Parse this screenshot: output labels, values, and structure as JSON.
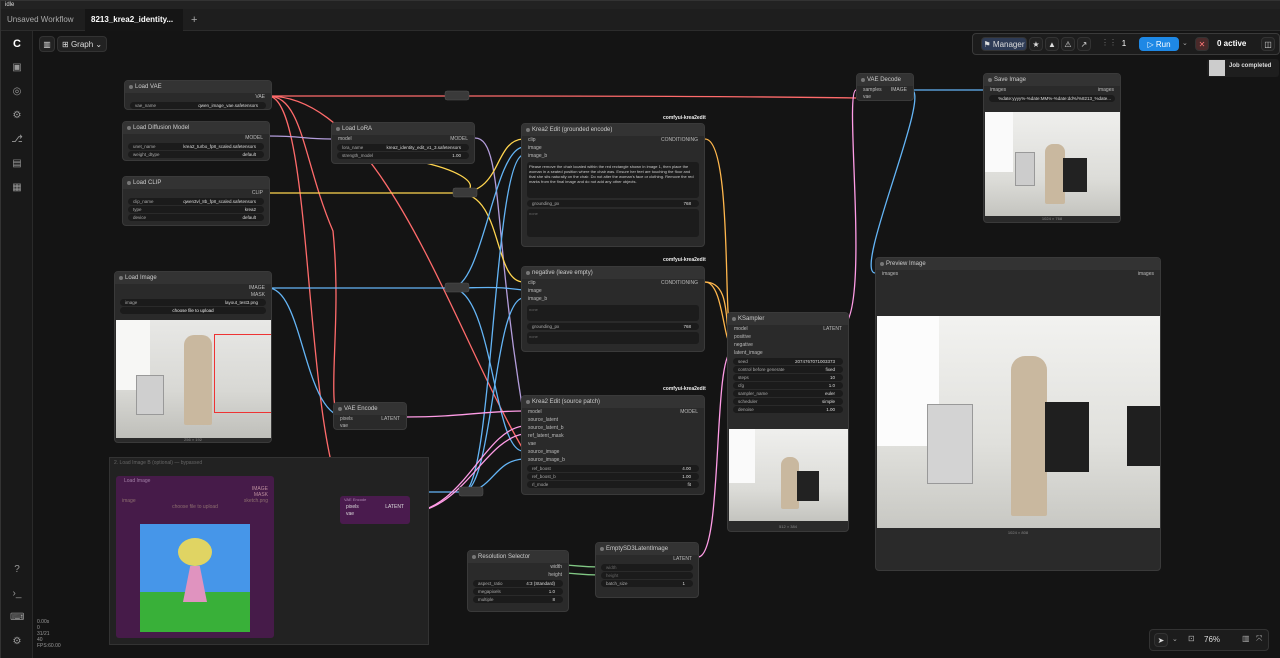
{
  "window": {
    "title": "idle"
  },
  "tabs": [
    {
      "label": "Unsaved Workflow"
    },
    {
      "label": "8213_krea2_identity..."
    }
  ],
  "toolbar": {
    "graph_label": "Graph",
    "manager_label": "Manager",
    "queue_count": "1",
    "run_label": "Run",
    "active_label": "0 active",
    "toast": "Job completed"
  },
  "stats": [
    "0.00s",
    "0",
    "31/21",
    "40",
    "FPS:60.00"
  ],
  "zoom": "76%",
  "nodes": {
    "load_vae": {
      "title": "Load VAE",
      "out": "VAE",
      "w1_label": "vae_name",
      "w1_value": "qwen_image_vae.safetensors"
    },
    "load_diffusion": {
      "title": "Load Diffusion Model",
      "out": "MODEL",
      "w1_label": "unet_name",
      "w1_value": "krea2_turbo_fp8_scaled.safetensors",
      "w2_label": "weight_dtype",
      "w2_value": "default"
    },
    "load_clip": {
      "title": "Load CLIP",
      "out": "CLIP",
      "w1_label": "clip_name",
      "w1_value": "qwen3vl_8b_fp8_scaled.safetensors",
      "w2_label": "type",
      "w2_value": "krea2",
      "w3_label": "device",
      "w3_value": "default"
    },
    "load_lora": {
      "title": "Load LoRA",
      "in1": "model",
      "in2": "clip",
      "out1": "MODEL",
      "out2": "CLIP",
      "w1_label": "lora_name",
      "w1_value": "krea2_identity_edit_v1_3.safetensors",
      "w2_label": "strength_model",
      "w2_value": "1.00"
    },
    "load_image": {
      "title": "Load Image",
      "out1": "IMAGE",
      "out2": "MASK",
      "w1_label": "image",
      "w1_value": "layout_test3.png",
      "upload": "choose file to upload",
      "size": "256 × 192"
    },
    "vae_encode": {
      "title": "VAE Encode",
      "in1": "pixels",
      "in2": "vae",
      "out": "LATENT"
    },
    "krea_edit_pos": {
      "tag": "comfyui-krea2edit",
      "title": "Krea2 Edit (grounded encode)",
      "in1": "clip",
      "in2": "image",
      "in3": "image_b",
      "out": "CONDITIONING",
      "prompt": "Please remove the chair located within the red rectangle shown in image 1, then place the woman in a seated position where the chair was. Ensure her feet are touching the floor and that she sits naturally on the chair. Do not alter the woman's face or clothing. Remove the red marks from the final image and do not add any other objects.",
      "w1_label": "grounding_px",
      "w1_value": "768",
      "neg_placeholder": "none"
    },
    "krea_edit_neg": {
      "tag": "comfyui-krea2edit",
      "title": "negative (leave empty)",
      "in1": "clip",
      "in2": "image",
      "in3": "image_b",
      "out": "CONDITIONING",
      "w1_label": "grounding_px",
      "w1_value": "768",
      "placeholder": "none"
    },
    "krea_edit_patch": {
      "tag": "comfyui-krea2edit",
      "title": "Krea2 Edit (source patch)",
      "in": [
        "model",
        "source_latent",
        "source_latent_b",
        "ref_latent_mask",
        "vae",
        "source_image",
        "source_image_b"
      ],
      "out": "MODEL",
      "w1_label": "ref_boost",
      "w1_value": "4.00",
      "w2_label": "ref_boost_b",
      "w2_value": "1.00",
      "w3_label": "rl_mode",
      "w3_value": "fit"
    },
    "ksampler": {
      "title": "KSampler",
      "in": [
        "model",
        "positive",
        "negative",
        "latent_image"
      ],
      "out": "LATENT",
      "widgets": [
        [
          "seed",
          "2074767071003373"
        ],
        [
          "control before generate",
          "fixed"
        ],
        [
          "steps",
          "10"
        ],
        [
          "cfg",
          "1.0"
        ],
        [
          "sampler_name",
          "euler"
        ],
        [
          "scheduler",
          "simple"
        ],
        [
          "denoise",
          "1.00"
        ]
      ],
      "size": "512 × 384"
    },
    "vae_decode": {
      "title": "VAE Decode",
      "in1": "samples",
      "in2": "vae",
      "out": "IMAGE"
    },
    "save_image": {
      "title": "Save Image",
      "in": "images",
      "out": "images",
      "w1_value": "%date:yyyy%-%date:MM%-%date:dd%/%8213_%date...",
      "size": "1024 × 768"
    },
    "preview_image": {
      "title": "Preview Image",
      "in": "images",
      "out": "images",
      "size": "1024 × 808"
    },
    "resolution": {
      "title": "Resolution Selector",
      "out1": "width",
      "out2": "height",
      "widgets": [
        [
          "aspect_ratio",
          "4:3 (Standard)"
        ],
        [
          "megapixels",
          "1.0"
        ],
        [
          "multiple",
          "8"
        ]
      ]
    },
    "empty_latent": {
      "title": "EmptySD3LatentImage",
      "in1": "width",
      "in2": "height",
      "out": "LATENT",
      "w1_label": "batch_size",
      "w1_value": "1"
    },
    "group2": {
      "title": "2. Load Image B (optional) — bypassed",
      "node_title": "Load Image",
      "out1": "IMAGE",
      "out2": "MASK",
      "image_label": "image",
      "image_value": "sketch.png",
      "upload": "choose file to upload",
      "encode_title": "VAE Encode",
      "encode_in1": "pixels",
      "encode_in2": "vae",
      "encode_out": "LATENT"
    }
  },
  "colors": {
    "vae": "#ff6b6b",
    "model": "#b39ddb",
    "clip": "#ffd54f",
    "image": "#64b5f6",
    "latent": "#ff9ce6",
    "conditioning": "#ffb74d",
    "int": "#81c784",
    "run": "#1e88e5"
  }
}
